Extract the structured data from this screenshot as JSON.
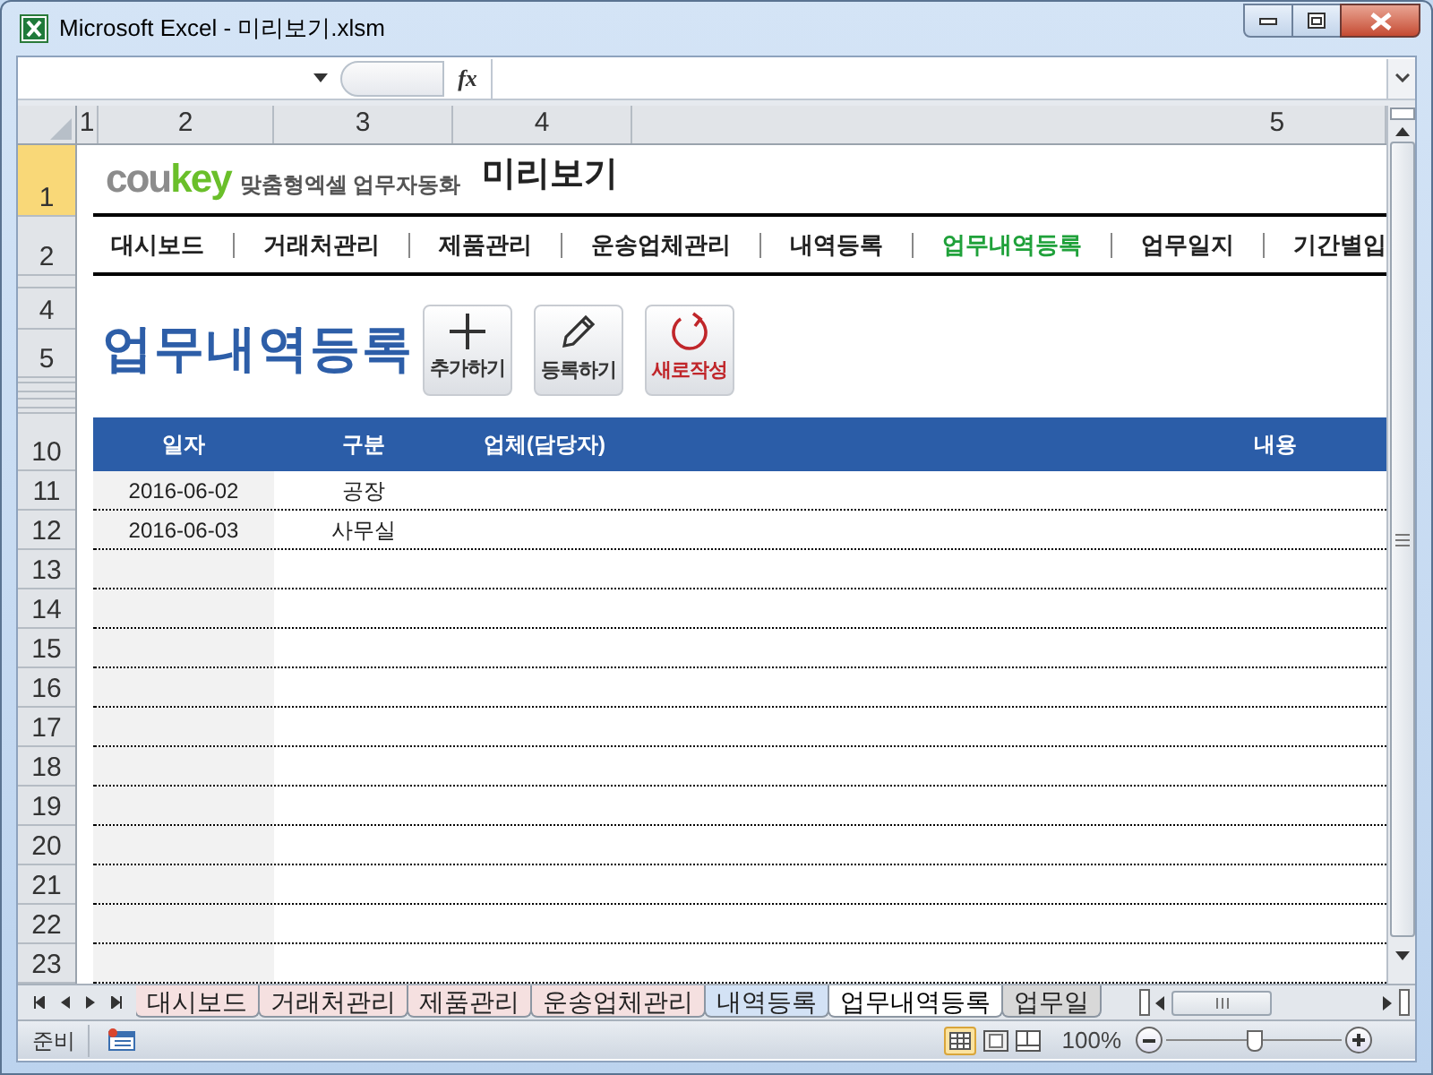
{
  "window": {
    "title": "Microsoft Excel - 미리보기.xlsm"
  },
  "column_headers": [
    "1",
    "2",
    "3",
    "4",
    "5"
  ],
  "formula_bar": {
    "function_label": "fx"
  },
  "row_headers": [
    "1",
    "2",
    "4",
    "5",
    "10",
    "11",
    "12",
    "13",
    "14",
    "15",
    "16",
    "17",
    "18",
    "19",
    "20",
    "21",
    "22",
    "23"
  ],
  "logo": {
    "parts": [
      {
        "text": "cou",
        "color": "#8c8c8c"
      },
      {
        "text": "key",
        "color": "#6abf2a"
      }
    ],
    "tagline": "맞춤형엑셀 업무자동화"
  },
  "page_title": "미리보기",
  "nav": [
    {
      "label": "대시보드",
      "selected": false
    },
    {
      "label": "거래처관리",
      "selected": false
    },
    {
      "label": "제품관리",
      "selected": false
    },
    {
      "label": "운송업체관리",
      "selected": false
    },
    {
      "label": "내역등록",
      "selected": false
    },
    {
      "label": "업무내역등록",
      "selected": true
    },
    {
      "label": "업무일지",
      "selected": false
    },
    {
      "label": "기간별입",
      "selected": false
    }
  ],
  "heading": "업무내역등록",
  "buttons": [
    {
      "kind": "add",
      "label": "추가하기"
    },
    {
      "kind": "edit",
      "label": "등록하기"
    },
    {
      "kind": "refresh",
      "label": "새로작성"
    }
  ],
  "table": {
    "columns": [
      "일자",
      "구분",
      "업체(담당자)",
      "내용"
    ],
    "rows": [
      [
        "2016-06-02",
        "공장"
      ],
      [
        "2016-06-03",
        "사무실"
      ]
    ]
  },
  "sheet_tabs": [
    {
      "label": "대시보드",
      "selected": false,
      "color": "#f5e0e0"
    },
    {
      "label": "거래처관리",
      "selected": false,
      "color": "#f5e0e0"
    },
    {
      "label": "제품관리",
      "selected": false,
      "color": "#f5e0e0"
    },
    {
      "label": "운송업체관리",
      "selected": false,
      "color": "#f5e0e0"
    },
    {
      "label": "내역등록",
      "selected": false,
      "color": "#d3e2f5"
    },
    {
      "label": "업무내역등록",
      "selected": true,
      "color": "#ffffff"
    },
    {
      "label": "업무일",
      "selected": false,
      "color": "#d8d8d8"
    }
  ],
  "status_bar": {
    "status": "준비",
    "zoom": "100%",
    "zoom_level": {
      "level": 0.5
    }
  }
}
